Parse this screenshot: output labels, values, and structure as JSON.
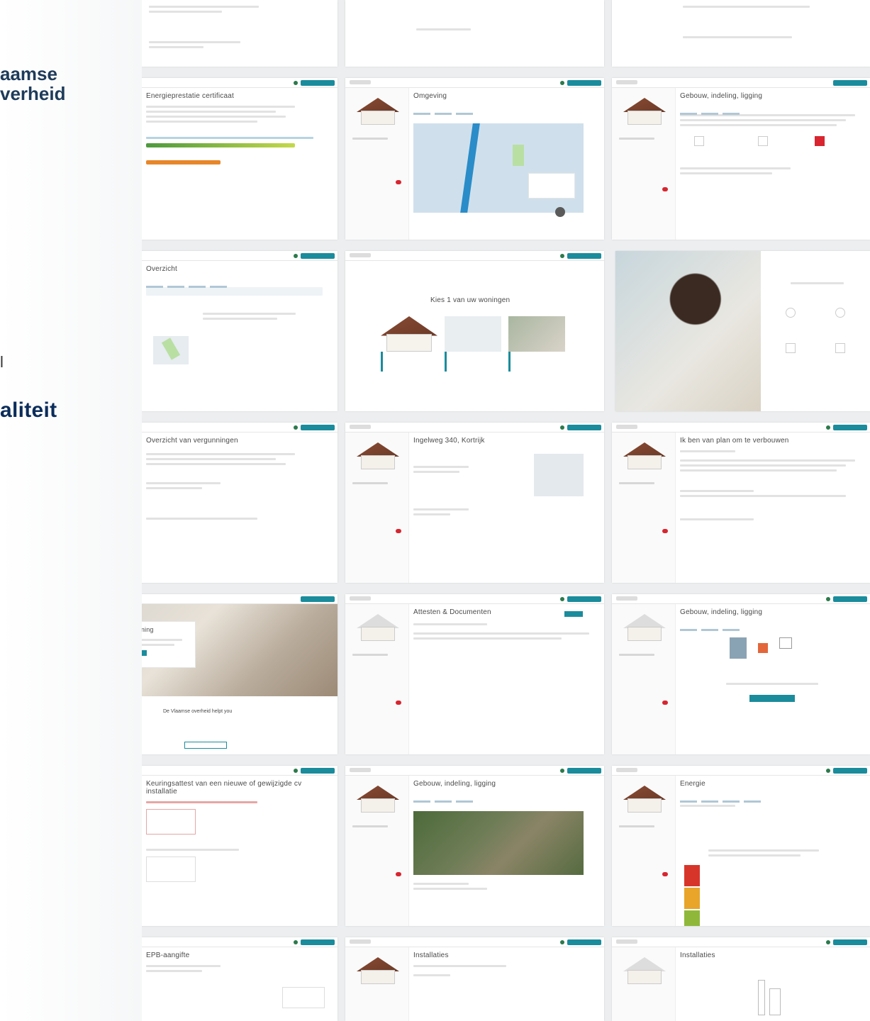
{
  "brand": {
    "line1": "aamse",
    "line2": "verheid"
  },
  "hero": {
    "bar": "l",
    "word": "aliteit"
  },
  "tiles": {
    "epc": {
      "title": "Energieprestatie certificaat"
    },
    "omgeving": {
      "title": "Omgeving"
    },
    "gebouw1": {
      "title": "Gebouw, indeling, ligging"
    },
    "overview": {
      "title": "Overzicht"
    },
    "kies": {
      "title": "Kies 1 van uw woningen"
    },
    "vergunningen": {
      "title": "Overzicht van vergunningen"
    },
    "adres": {
      "title": "Ingelweg 340, Kortrijk"
    },
    "verbouwen": {
      "title": "Ik ben van plan om te verbouwen"
    },
    "ken": {
      "title": "Ken uw woning",
      "subtitle": "De Vlaamse overheid helpt you"
    },
    "attesten": {
      "title": "Attesten & Documenten"
    },
    "gebouw2": {
      "title": "Gebouw, indeling, ligging"
    },
    "keuring": {
      "title": "Keuringsattest van een nieuwe of gewijzigde cv installatie"
    },
    "gebouw3": {
      "title": "Gebouw, indeling, ligging"
    },
    "energie": {
      "title": "Energie"
    },
    "epb": {
      "title": "EPB-aangifte"
    },
    "installaties1": {
      "title": "Installaties"
    },
    "installaties2": {
      "title": "Installaties"
    }
  },
  "colors": {
    "teal": "#1a8c9c",
    "brand_navy": "#1e3b5a",
    "alert_red": "#d8252f",
    "green": "#2b7a4b"
  }
}
